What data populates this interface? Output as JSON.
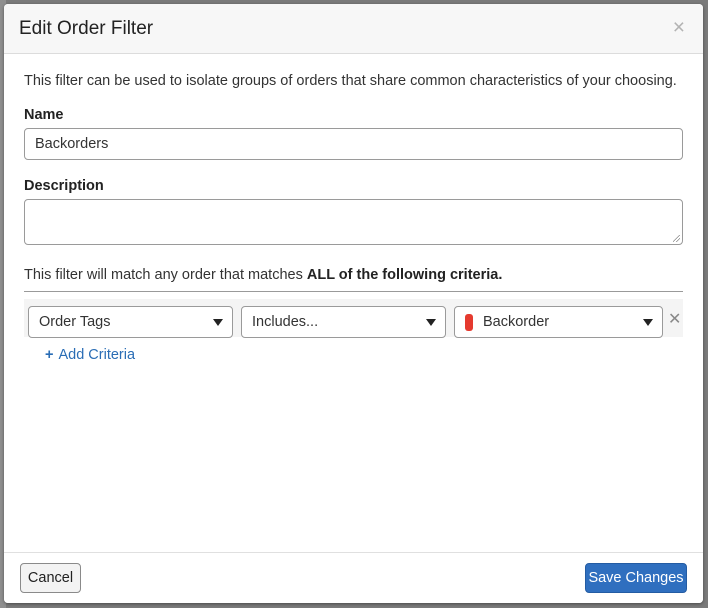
{
  "modal": {
    "title": "Edit Order Filter",
    "close_icon": "×"
  },
  "form": {
    "intro": "This filter can be used to isolate groups of orders that share common characteristics of your choosing.",
    "name_label": "Name",
    "name_value": "Backorders",
    "description_label": "Description",
    "description_value": "",
    "criteria_intro_prefix": "This filter will match any order that matches ",
    "criteria_intro_bold": "ALL of the following criteria",
    "criteria_intro_suffix": "."
  },
  "criteria": [
    {
      "field": "Order Tags",
      "operator": "Includes...",
      "value": "Backorder",
      "tag_color": "#e53a2f"
    }
  ],
  "add_criteria": {
    "icon": "+",
    "label": "Add Criteria"
  },
  "footer": {
    "cancel_label": "Cancel",
    "save_label": "Save Changes"
  },
  "colors": {
    "accent": "#2f6fbf",
    "link": "#2a6db5",
    "tag_red": "#e53a2f"
  }
}
